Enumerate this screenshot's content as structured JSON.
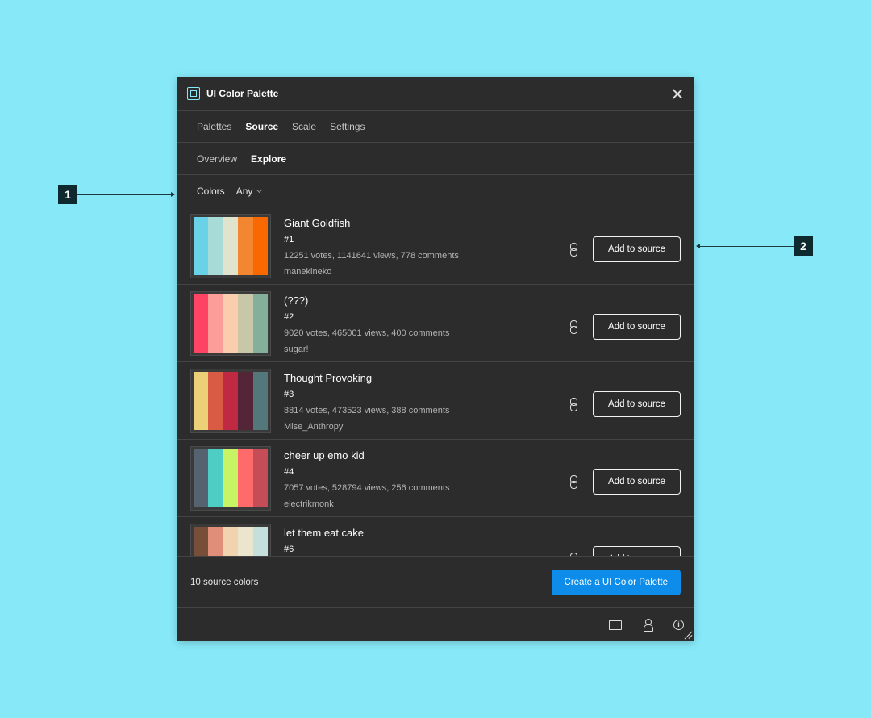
{
  "annotations": {
    "callout1": "1",
    "callout2": "2"
  },
  "window": {
    "title": "UI Color Palette",
    "app_icon": "frame-icon",
    "close_icon": "close-icon"
  },
  "tabs": [
    "Palettes",
    "Source",
    "Scale",
    "Settings"
  ],
  "active_tab": "Source",
  "subtabs": [
    "Overview",
    "Explore"
  ],
  "active_subtab": "Explore",
  "filter": {
    "label": "Colors",
    "value": "Any"
  },
  "palettes": [
    {
      "name": "Giant Goldfish",
      "rank": "#1",
      "stats": "12251 votes, 1141641 views, 778 comments",
      "author": "manekineko",
      "colors": [
        "#69d2e7",
        "#a7dbd8",
        "#e0e4cc",
        "#f38630",
        "#fa6900"
      ],
      "action": "Add to source"
    },
    {
      "name": "(???)",
      "rank": "#2",
      "stats": "9020 votes, 465001 views, 400 comments",
      "author": "sugar!",
      "colors": [
        "#fe4365",
        "#fc9d9a",
        "#f9cdad",
        "#c8c8a9",
        "#83af9b"
      ],
      "action": "Add to source"
    },
    {
      "name": "Thought Provoking",
      "rank": "#3",
      "stats": "8814 votes, 473523 views, 388 comments",
      "author": "Mise_Anthropy",
      "colors": [
        "#ecd078",
        "#d95b43",
        "#c02942",
        "#542437",
        "#53777a"
      ],
      "action": "Add to source"
    },
    {
      "name": "cheer up emo kid",
      "rank": "#4",
      "stats": "7057 votes, 528794 views, 256 comments",
      "author": "electrikmonk",
      "colors": [
        "#556270",
        "#4ecdc4",
        "#c7f464",
        "#ff6b6b",
        "#c44d58"
      ],
      "action": "Add to source"
    },
    {
      "name": "let them eat cake",
      "rank": "#6",
      "stats": "",
      "author": "",
      "colors": [
        "#774f38",
        "#e08e79",
        "#f1d4af",
        "#ece5ce",
        "#c5e0dc"
      ],
      "action": "Add to source"
    }
  ],
  "footer": {
    "count_text": "10 source colors",
    "primary_action": "Create a UI Color Palette"
  },
  "bottom_icons": [
    "book-icon",
    "user-icon",
    "info-icon"
  ],
  "colors": {
    "background": "#87e9f8",
    "panel": "#2c2c2c",
    "primary": "#0d8ce9"
  }
}
